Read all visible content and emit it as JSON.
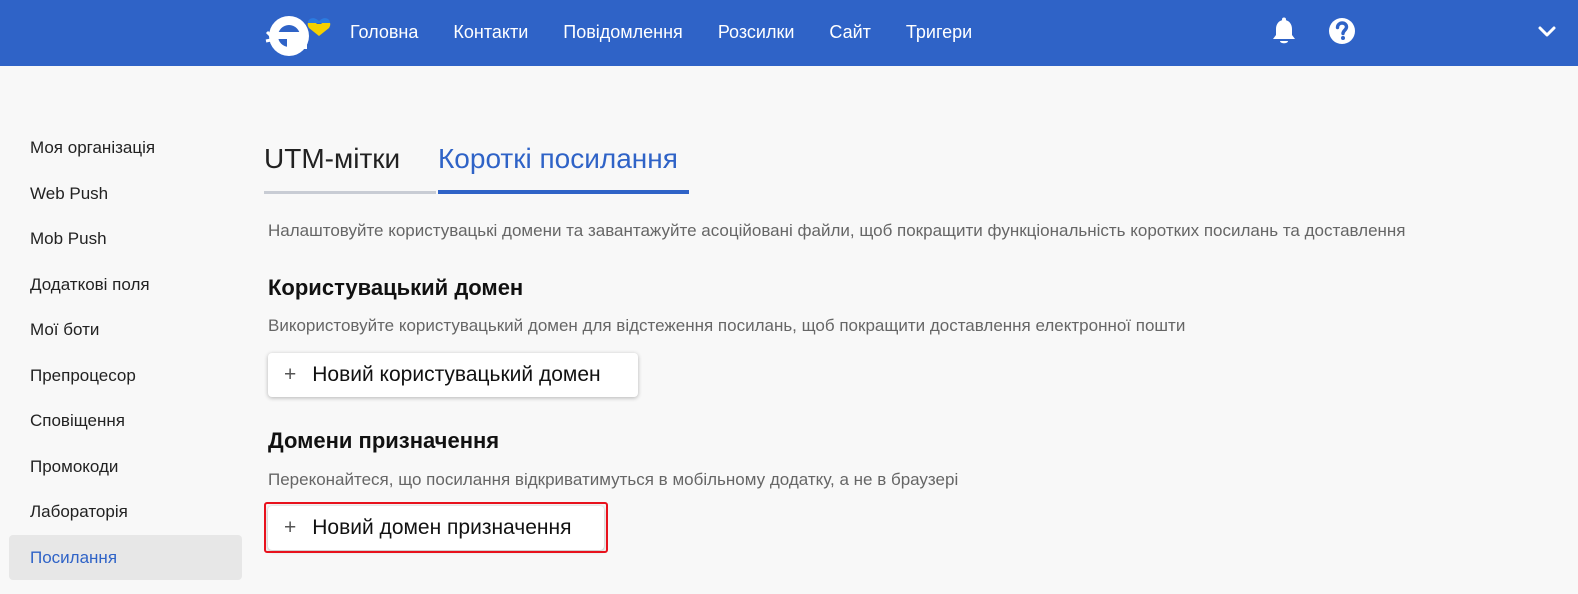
{
  "header": {
    "brand_color": "#2f63c7",
    "logo_icon": "esputnik-logo-with-heart",
    "nav": [
      "Головна",
      "Контакти",
      "Повідомлення",
      "Розсилки",
      "Сайт",
      "Тригери"
    ],
    "icons": [
      "bell-icon",
      "help-icon",
      "chevron-down-icon"
    ]
  },
  "sidebar": {
    "items": [
      "Моя організація",
      "Web Push",
      "Mob Push",
      "Додаткові поля",
      "Мої боти",
      "Препроцесор",
      "Сповіщення",
      "Промокоди",
      "Лабораторія",
      "Посилання"
    ],
    "active": "Посилання"
  },
  "tabs": {
    "utm": "UTM-мітки",
    "short_links": "Короткі посилання",
    "active": "Короткі посилання"
  },
  "content": {
    "description": "Налаштовуйте користувацькі домени та завантажуйте асоційовані файли, щоб покращити функціональність коротких посилань та доставлення",
    "custom_domain": {
      "title": "Користувацький домен",
      "description": "Використовуйте користувацький домен для відстеження посилань, щоб покращити доставлення електронної пошти",
      "button_plus": "+",
      "button_label": "Новий користувацький домен"
    },
    "destination_domains": {
      "title": "Домени призначення",
      "description": "Переконайтеся, що посилання відкриватимуться в мобільному додатку, а не в браузері",
      "button_plus": "+",
      "button_label": "Новий домен призначення",
      "highlight_color": "#e8121d"
    }
  }
}
